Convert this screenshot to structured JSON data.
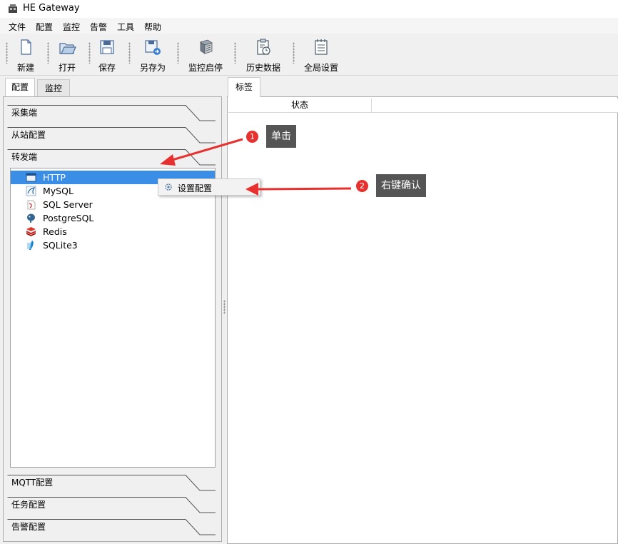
{
  "window": {
    "title": "HE Gateway"
  },
  "menu": [
    "文件",
    "配置",
    "监控",
    "告警",
    "工具",
    "帮助"
  ],
  "toolbar": {
    "new": "新建",
    "open": "打开",
    "save": "保存",
    "save_as": "另存为",
    "monitor_toggle": "监控启停",
    "history": "历史数据",
    "global_settings": "全局设置"
  },
  "left_tabs": [
    "配置",
    "监控"
  ],
  "groups": {
    "collector": "采集端",
    "slave": "从站配置",
    "forwarder": "转发端",
    "mqtt": "MQTT配置",
    "task": "任务配置",
    "alarm": "告警配置"
  },
  "forwarders": [
    {
      "label": "HTTP",
      "icon": "window-icon",
      "selected": true
    },
    {
      "label": "MySQL",
      "icon": "mysql-icon",
      "selected": false
    },
    {
      "label": "SQL Server",
      "icon": "sqlserver-icon",
      "selected": false
    },
    {
      "label": "PostgreSQL",
      "icon": "postgresql-icon",
      "selected": false
    },
    {
      "label": "Redis",
      "icon": "redis-icon",
      "selected": false
    },
    {
      "label": "SQLite3",
      "icon": "sqlite-icon",
      "selected": false
    }
  ],
  "right_panel": {
    "tab": "标签",
    "column": "状态"
  },
  "context_menu": {
    "item": "设置配置"
  },
  "annotations": [
    {
      "number": "1",
      "text": "单击"
    },
    {
      "number": "2",
      "text": "右键确认"
    }
  ],
  "colors": {
    "selection": "#3a8ee6",
    "annotation_red": "#e8312f",
    "callout_bg": "#555555"
  }
}
